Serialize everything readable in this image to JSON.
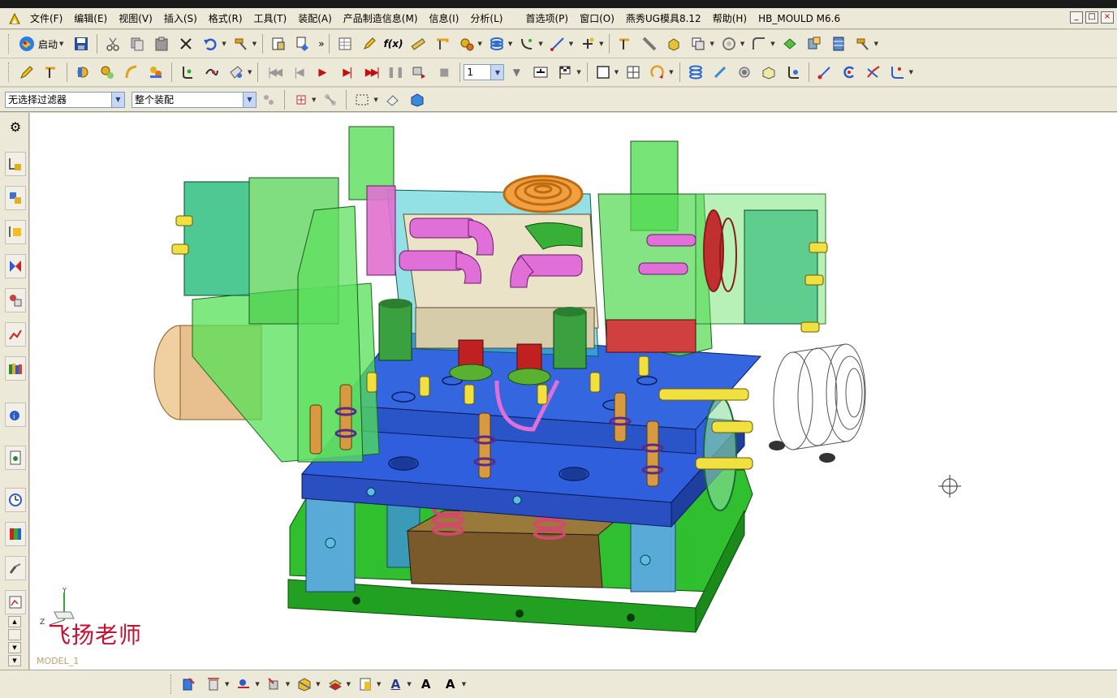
{
  "window": {
    "controls": [
      "_",
      "□",
      "×"
    ]
  },
  "menu": {
    "items": [
      {
        "id": "file",
        "label": "文件(F)"
      },
      {
        "id": "edit",
        "label": "编辑(E)"
      },
      {
        "id": "view",
        "label": "视图(V)"
      },
      {
        "id": "insert",
        "label": "插入(S)"
      },
      {
        "id": "format",
        "label": "格式(R)"
      },
      {
        "id": "tools",
        "label": "工具(T)"
      },
      {
        "id": "assembly",
        "label": "装配(A)"
      },
      {
        "id": "pmi",
        "label": "产品制造信息(M)"
      },
      {
        "id": "info",
        "label": "信息(I)"
      },
      {
        "id": "analysis",
        "label": "分析(L)"
      },
      {
        "id": "preferences",
        "label": "首选项(P)"
      },
      {
        "id": "window",
        "label": "窗口(O)"
      },
      {
        "id": "yanxiu",
        "label": "燕秀UG模具8.12"
      },
      {
        "id": "help",
        "label": "帮助(H)"
      },
      {
        "id": "hbmould",
        "label": "HB_MOULD M6.6"
      }
    ]
  },
  "toolbar": {
    "start_label": "启动",
    "step_value": "1"
  },
  "filters": {
    "selection_filter": "无选择过滤器",
    "scope": "整个装配"
  },
  "viewport": {
    "model_name": "MODEL_1",
    "watermark": "飞扬老师",
    "axis_y": "Y",
    "axis_z": "Z"
  },
  "colors": {
    "chrome": "#ece9d8",
    "plate_blue": "#2f5fdc",
    "plate_green": "#3cc43c",
    "slider_green": "#55e055",
    "pink": "#e070d0",
    "gold": "#d8a040",
    "watermark_red": "#c8102e"
  }
}
